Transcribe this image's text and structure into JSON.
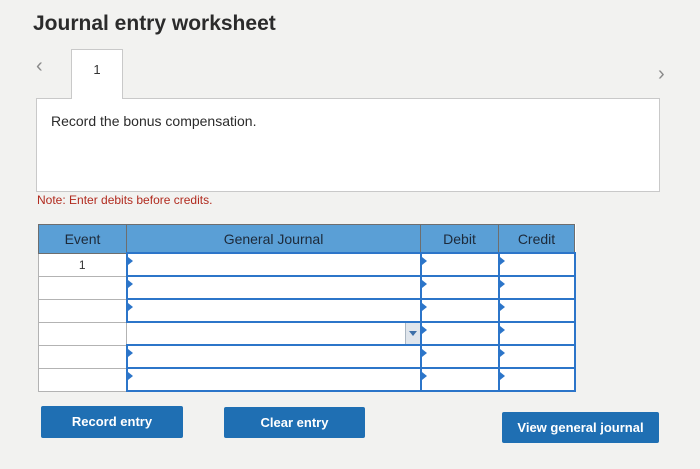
{
  "page": {
    "title": "Journal entry worksheet"
  },
  "tabs": {
    "current": "1",
    "prev_icon": "chevron-left",
    "next_icon": "chevron-right"
  },
  "panel": {
    "instruction": "Record the bonus compensation."
  },
  "note": "Note: Enter debits before credits.",
  "grid": {
    "headers": {
      "event": "Event",
      "journal": "General Journal",
      "debit": "Debit",
      "credit": "Credit"
    },
    "rows": [
      {
        "event": "1",
        "journal": "",
        "debit": "",
        "credit": ""
      },
      {
        "event": "",
        "journal": "",
        "debit": "",
        "credit": ""
      },
      {
        "event": "",
        "journal": "",
        "debit": "",
        "credit": ""
      },
      {
        "event": "",
        "journal": "",
        "debit": "",
        "credit": ""
      },
      {
        "event": "",
        "journal": "",
        "debit": "",
        "credit": ""
      },
      {
        "event": "",
        "journal": "",
        "debit": "",
        "credit": ""
      }
    ]
  },
  "buttons": {
    "record": "Record entry",
    "clear": "Clear entry",
    "view": "View general journal"
  },
  "colors": {
    "header_blue": "#5a9fd6",
    "button_blue": "#1f6fb3",
    "note_red": "#b12a1e",
    "field_border": "#2c75c9"
  }
}
